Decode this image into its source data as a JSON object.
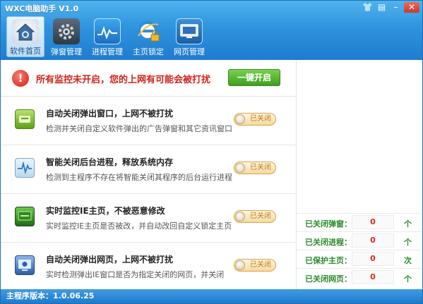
{
  "window": {
    "title": "WXC电脑助手 V1.0",
    "controls": [
      "shirt-icon",
      "menu-icon",
      "minimize-icon",
      "close-icon"
    ]
  },
  "toolbar": {
    "items": [
      {
        "label": "软件首页",
        "icon": "home-icon",
        "active": true
      },
      {
        "label": "弹窗管理",
        "icon": "gear-icon",
        "active": false
      },
      {
        "label": "进程管理",
        "icon": "chart-icon",
        "active": false
      },
      {
        "label": "主页锁定",
        "icon": "ie-lock-icon",
        "active": false
      },
      {
        "label": "网页管理",
        "icon": "monitor-icon",
        "active": false
      }
    ]
  },
  "warning": {
    "text": "所有监控未开启，您的上网有可能会被打扰",
    "button_label": "一键开启"
  },
  "features": [
    {
      "title": "自动关闭弹出窗口，上网不被打扰",
      "desc": "检测并关闭自定义软件弹出的广告弹窗和其它资讯窗口",
      "toggle": "已关闭",
      "icon": "popup-icon"
    },
    {
      "title": "智能关闭后台进程，释放系统内存",
      "desc": "检测到主程序不存在将智能关闭其程序的后台运行进程",
      "toggle": "已关闭",
      "icon": "process-icon"
    },
    {
      "title": "实时监控IE主页，不被恶意修改",
      "desc": "实时监控IE主页是否被改，并自动改回自定义锁定主页",
      "toggle": "已关闭",
      "icon": "homepage-icon"
    },
    {
      "title": "自动关闭弹出网页，上网不被打扰",
      "desc": "实时检测弹出IE窗口是否为指定关闭的网页，并关闭",
      "toggle": "已关闭",
      "icon": "webpage-icon"
    }
  ],
  "stats": [
    {
      "label": "已关闭弹窗：",
      "value": "0",
      "unit": "个"
    },
    {
      "label": "已关闭进程：",
      "value": "0",
      "unit": "个"
    },
    {
      "label": "已保护主页：",
      "value": "0",
      "unit": "次"
    },
    {
      "label": "已关闭网页：",
      "value": "0",
      "unit": "个"
    }
  ],
  "statusbar": {
    "version": "主程序版本：1.0.06.25"
  },
  "colors": {
    "title_blue": "#2f93de",
    "warning_red": "#d0231c",
    "green_button": "#3f9f1f",
    "stat_green": "#2a8a2a",
    "stat_red": "#e0261c"
  }
}
